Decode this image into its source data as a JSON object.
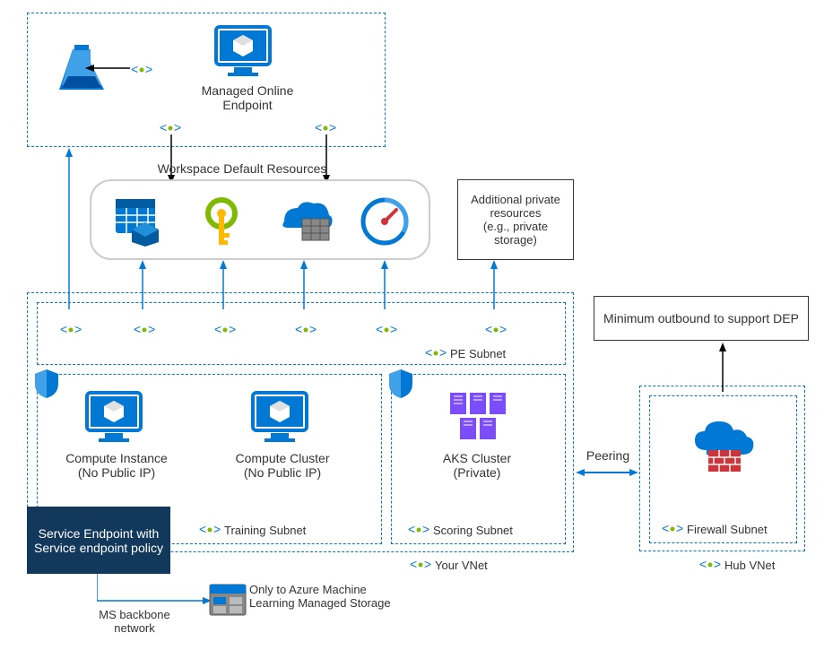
{
  "top": {
    "managed_endpoint": "Managed Online Endpoint"
  },
  "workspace": {
    "title": "Workspace Default Resources"
  },
  "additional": {
    "text": "Additional private resources\n(e.g., private storage)"
  },
  "yourvnet": {
    "pe_subnet": "PE Subnet",
    "compute_instance": "Compute Instance (No Public IP)",
    "compute_cluster": "Compute Cluster (No Public IP)",
    "training_subnet": "Training Subnet",
    "aks_cluster": "AKS Cluster (Private)",
    "scoring_subnet": "Scoring Subnet",
    "label": "Your VNet"
  },
  "service_endpoint": {
    "title": "Service Endpoint with  Service endpoint policy",
    "ms_backbone": "MS backbone network",
    "storage_note": "Only to Azure Machine Learning Managed Storage"
  },
  "peering": "Peering",
  "hubvnet": {
    "firewall_subnet": "Firewall Subnet",
    "label": "Hub VNet",
    "outbound": "Minimum outbound to support DEP"
  }
}
